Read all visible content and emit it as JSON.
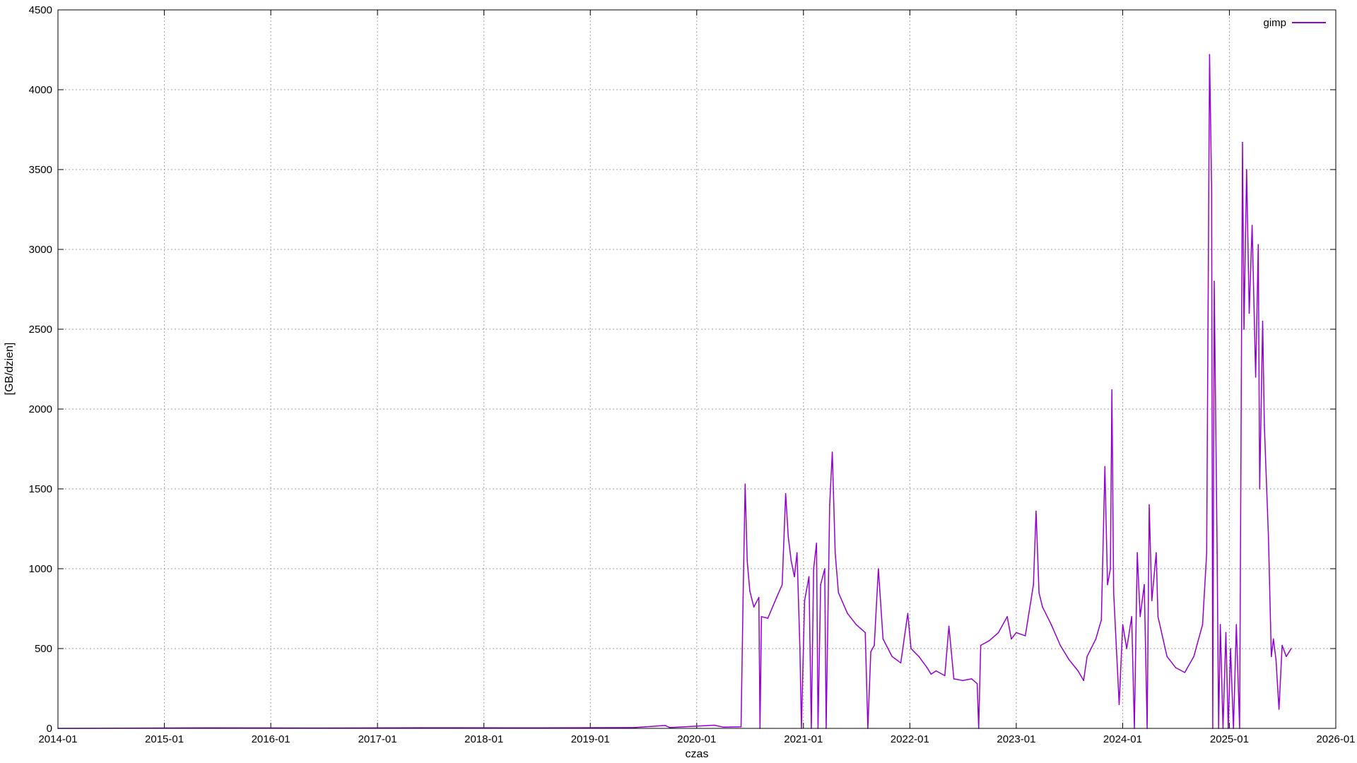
{
  "chart_data": {
    "type": "line",
    "title": "",
    "xlabel": "czas",
    "ylabel": "[GB/dzien]",
    "x_ticks": [
      "2014-01",
      "2015-01",
      "2016-01",
      "2017-01",
      "2018-01",
      "2019-01",
      "2020-01",
      "2021-01",
      "2022-01",
      "2023-01",
      "2024-01",
      "2025-01",
      "2026-01"
    ],
    "y_ticks": [
      0,
      500,
      1000,
      1500,
      2000,
      2500,
      3000,
      3500,
      4000,
      4500
    ],
    "xlim": [
      "2014-01",
      "2026-01"
    ],
    "ylim": [
      0,
      4500
    ],
    "grid": true,
    "legend_position": "top-right",
    "series": [
      {
        "name": "gimp",
        "color": "#9400d3",
        "points": [
          [
            "2014-01-01",
            0
          ],
          [
            "2015-06-01",
            3
          ],
          [
            "2016-06-01",
            2
          ],
          [
            "2017-06-01",
            4
          ],
          [
            "2018-06-01",
            3
          ],
          [
            "2019-06-01",
            5
          ],
          [
            "2019-09-15",
            18
          ],
          [
            "2019-10-01",
            5
          ],
          [
            "2020-03-01",
            20
          ],
          [
            "2020-04-01",
            8
          ],
          [
            "2020-06-01",
            10
          ],
          [
            "2020-06-08",
            820
          ],
          [
            "2020-06-15",
            1530
          ],
          [
            "2020-06-22",
            1050
          ],
          [
            "2020-07-01",
            860
          ],
          [
            "2020-07-15",
            760
          ],
          [
            "2020-08-01",
            820
          ],
          [
            "2020-08-05",
            0
          ],
          [
            "2020-08-10",
            700
          ],
          [
            "2020-09-01",
            690
          ],
          [
            "2020-10-01",
            820
          ],
          [
            "2020-10-20",
            900
          ],
          [
            "2020-11-01",
            1470
          ],
          [
            "2020-11-10",
            1200
          ],
          [
            "2020-11-20",
            1050
          ],
          [
            "2020-12-01",
            950
          ],
          [
            "2020-12-10",
            1100
          ],
          [
            "2020-12-20",
            500
          ],
          [
            "2020-12-25",
            0
          ],
          [
            "2021-01-05",
            800
          ],
          [
            "2021-01-20",
            950
          ],
          [
            "2021-01-28",
            0
          ],
          [
            "2021-02-05",
            1000
          ],
          [
            "2021-02-15",
            1160
          ],
          [
            "2021-02-20",
            0
          ],
          [
            "2021-03-01",
            900
          ],
          [
            "2021-03-15",
            1000
          ],
          [
            "2021-03-20",
            0
          ],
          [
            "2021-04-01",
            1400
          ],
          [
            "2021-04-10",
            1730
          ],
          [
            "2021-04-20",
            1100
          ],
          [
            "2021-05-01",
            850
          ],
          [
            "2021-06-01",
            720
          ],
          [
            "2021-07-01",
            650
          ],
          [
            "2021-08-01",
            600
          ],
          [
            "2021-08-10",
            0
          ],
          [
            "2021-08-20",
            480
          ],
          [
            "2021-09-01",
            520
          ],
          [
            "2021-09-15",
            1000
          ],
          [
            "2021-10-01",
            560
          ],
          [
            "2021-11-01",
            450
          ],
          [
            "2021-12-01",
            410
          ],
          [
            "2021-12-25",
            720
          ],
          [
            "2022-01-05",
            500
          ],
          [
            "2022-02-01",
            450
          ],
          [
            "2022-03-01",
            380
          ],
          [
            "2022-03-15",
            340
          ],
          [
            "2022-04-01",
            360
          ],
          [
            "2022-05-01",
            330
          ],
          [
            "2022-05-15",
            640
          ],
          [
            "2022-06-01",
            310
          ],
          [
            "2022-07-01",
            300
          ],
          [
            "2022-08-01",
            310
          ],
          [
            "2022-08-20",
            280
          ],
          [
            "2022-08-25",
            0
          ],
          [
            "2022-09-01",
            520
          ],
          [
            "2022-10-01",
            550
          ],
          [
            "2022-11-01",
            600
          ],
          [
            "2022-12-01",
            700
          ],
          [
            "2022-12-15",
            560
          ],
          [
            "2023-01-01",
            600
          ],
          [
            "2023-02-01",
            580
          ],
          [
            "2023-03-01",
            900
          ],
          [
            "2023-03-10",
            1360
          ],
          [
            "2023-03-20",
            850
          ],
          [
            "2023-04-01",
            760
          ],
          [
            "2023-05-01",
            650
          ],
          [
            "2023-06-01",
            520
          ],
          [
            "2023-07-01",
            430
          ],
          [
            "2023-08-01",
            360
          ],
          [
            "2023-08-20",
            300
          ],
          [
            "2023-09-01",
            450
          ],
          [
            "2023-10-01",
            560
          ],
          [
            "2023-10-20",
            680
          ],
          [
            "2023-11-01",
            1640
          ],
          [
            "2023-11-10",
            900
          ],
          [
            "2023-11-20",
            1000
          ],
          [
            "2023-11-25",
            2120
          ],
          [
            "2023-12-01",
            850
          ],
          [
            "2023-12-20",
            150
          ],
          [
            "2024-01-01",
            650
          ],
          [
            "2024-01-15",
            500
          ],
          [
            "2024-02-01",
            700
          ],
          [
            "2024-02-10",
            0
          ],
          [
            "2024-02-20",
            1100
          ],
          [
            "2024-03-01",
            700
          ],
          [
            "2024-03-15",
            900
          ],
          [
            "2024-03-25",
            0
          ],
          [
            "2024-04-01",
            1400
          ],
          [
            "2024-04-10",
            800
          ],
          [
            "2024-04-25",
            1100
          ],
          [
            "2024-05-01",
            700
          ],
          [
            "2024-06-01",
            450
          ],
          [
            "2024-07-01",
            380
          ],
          [
            "2024-08-01",
            350
          ],
          [
            "2024-09-01",
            450
          ],
          [
            "2024-10-01",
            650
          ],
          [
            "2024-10-15",
            1100
          ],
          [
            "2024-10-25",
            4220
          ],
          [
            "2024-11-01",
            3380
          ],
          [
            "2024-11-05",
            0
          ],
          [
            "2024-11-10",
            2800
          ],
          [
            "2024-11-20",
            1100
          ],
          [
            "2024-11-25",
            0
          ],
          [
            "2024-12-01",
            650
          ],
          [
            "2024-12-10",
            0
          ],
          [
            "2024-12-20",
            600
          ],
          [
            "2024-12-28",
            0
          ],
          [
            "2025-01-05",
            500
          ],
          [
            "2025-01-15",
            0
          ],
          [
            "2025-01-25",
            650
          ],
          [
            "2025-02-05",
            0
          ],
          [
            "2025-02-15",
            3670
          ],
          [
            "2025-02-20",
            2500
          ],
          [
            "2025-03-01",
            3500
          ],
          [
            "2025-03-10",
            2600
          ],
          [
            "2025-03-20",
            3150
          ],
          [
            "2025-04-01",
            2200
          ],
          [
            "2025-04-10",
            3030
          ],
          [
            "2025-04-15",
            1500
          ],
          [
            "2025-04-25",
            2550
          ],
          [
            "2025-05-01",
            1900
          ],
          [
            "2025-05-15",
            1200
          ],
          [
            "2025-05-25",
            450
          ],
          [
            "2025-06-01",
            560
          ],
          [
            "2025-06-10",
            430
          ],
          [
            "2025-06-20",
            120
          ],
          [
            "2025-07-01",
            520
          ],
          [
            "2025-07-15",
            450
          ],
          [
            "2025-08-01",
            500
          ]
        ]
      }
    ]
  }
}
